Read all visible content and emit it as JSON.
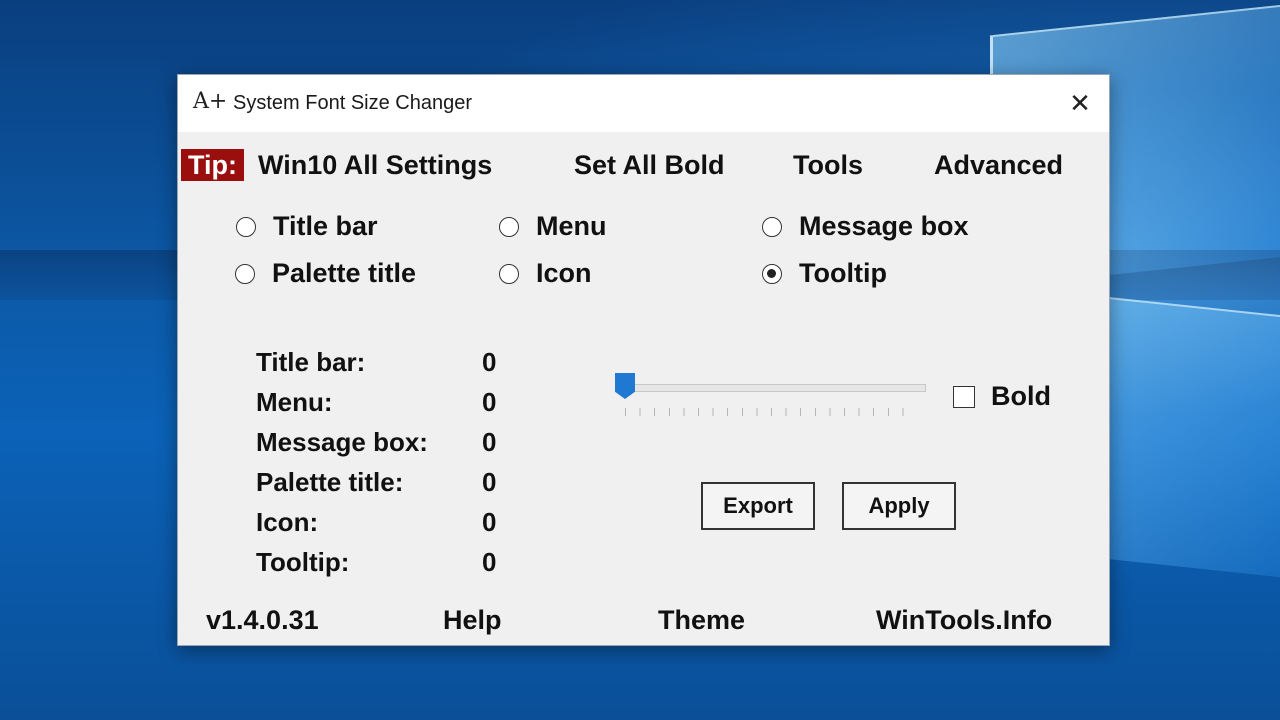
{
  "window": {
    "title": "System Font Size Changer",
    "icon": "A+"
  },
  "menu": {
    "tip": "Tip:",
    "items": [
      "Win10 All Settings",
      "Set All Bold",
      "Tools",
      "Advanced"
    ]
  },
  "radios": {
    "title_bar": {
      "label": "Title bar",
      "checked": false
    },
    "menu": {
      "label": "Menu",
      "checked": false
    },
    "message_box": {
      "label": "Message box",
      "checked": false
    },
    "palette_title": {
      "label": "Palette title",
      "checked": false
    },
    "icon": {
      "label": "Icon",
      "checked": false
    },
    "tooltip": {
      "label": "Tooltip",
      "checked": true
    }
  },
  "stats": [
    {
      "label": "Title bar:",
      "value": "0"
    },
    {
      "label": "Menu:",
      "value": "0"
    },
    {
      "label": "Message box:",
      "value": "0"
    },
    {
      "label": "Palette title:",
      "value": "0"
    },
    {
      "label": "Icon:",
      "value": "0"
    },
    {
      "label": "Tooltip:",
      "value": "0"
    }
  ],
  "slider": {
    "value": 0,
    "min": 0,
    "max": 20
  },
  "bold": {
    "label": "Bold",
    "checked": false
  },
  "buttons": {
    "export": "Export",
    "apply": "Apply"
  },
  "footer": {
    "version": "v1.4.0.31",
    "help": "Help",
    "theme": "Theme",
    "site": "WinTools.Info"
  },
  "colors": {
    "tip_bg": "#9b0e0e",
    "slider_thumb": "#1f78d1"
  }
}
